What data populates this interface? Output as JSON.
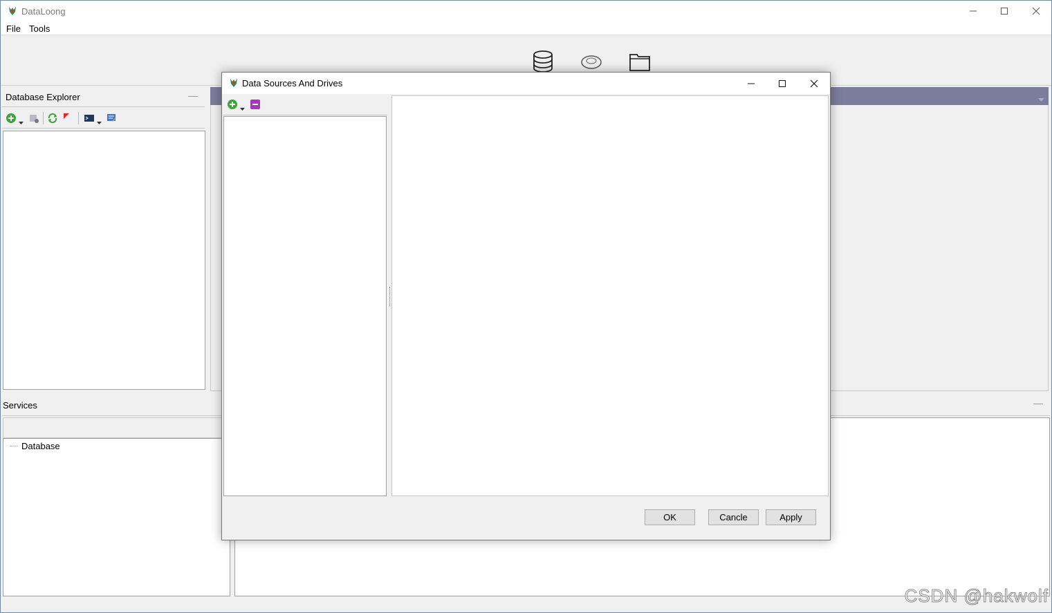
{
  "app": {
    "title": "DataLoong"
  },
  "menu": {
    "items": [
      "File",
      "Tools"
    ]
  },
  "toolbar": {
    "icons": [
      "database-icon",
      "cloud-drive-icon",
      "folder-icon"
    ]
  },
  "db_explorer": {
    "title": "Database Explorer",
    "toolbar_icons": [
      "add-connection-icon",
      "connection-settings-icon",
      "refresh-icon",
      "disconnect-icon",
      "terminal-icon",
      "sql-editor-icon"
    ]
  },
  "services": {
    "title": "Services",
    "tree": [
      {
        "label": "Database"
      }
    ]
  },
  "dialog": {
    "title": "Data Sources And Drives",
    "buttons": {
      "ok": "OK",
      "cancel": "Cancle",
      "apply": "Apply"
    }
  },
  "watermark": "CSDN @hakwolf",
  "colors": {
    "editor_header": "#7c7c9c",
    "add_green": "#3aa63a",
    "remove_purple": "#a23bb5"
  }
}
